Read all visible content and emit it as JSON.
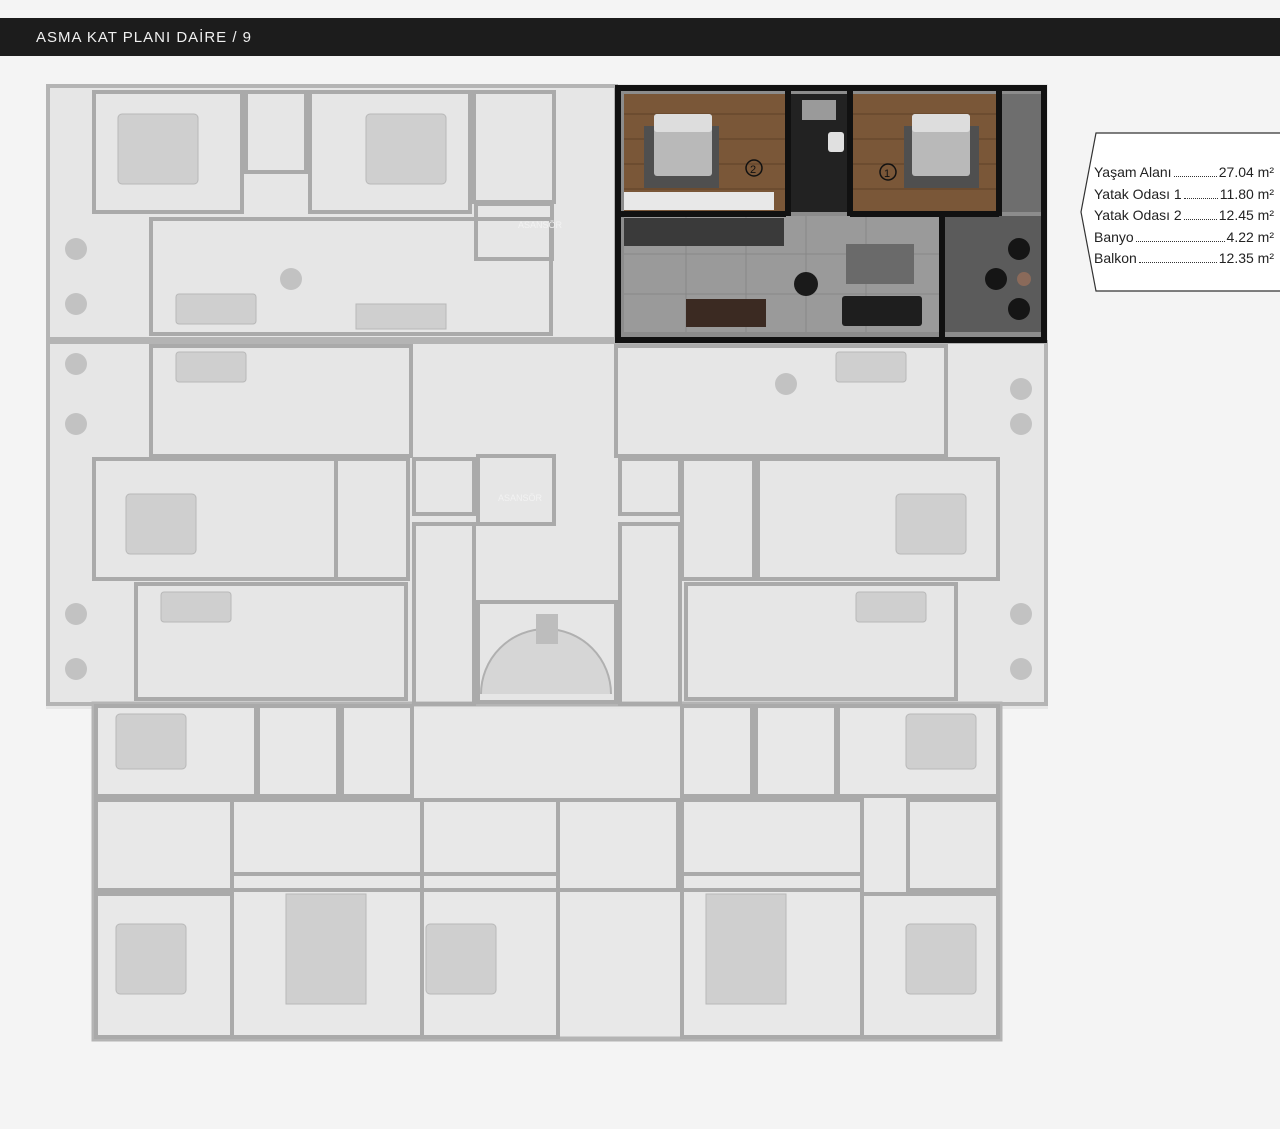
{
  "header": {
    "title": "ASMA KAT PLANI DAİRE / 9"
  },
  "plan": {
    "labels": {
      "elevator_1": "ASANSÖR",
      "elevator_2": "ASANSÖR",
      "room_1": "1",
      "room_2": "2"
    },
    "colors": {
      "highlight_wall": "#111111",
      "wood_floor": "#7a5738",
      "tile_floor": "#9a9a9a",
      "faded_wall": "#9c9c9c",
      "faded_fill": "#dcdcdc"
    }
  },
  "areas": [
    {
      "label": "Yaşam Alanı",
      "value": "27.04 m²"
    },
    {
      "label": "Yatak Odası 1",
      "value": "11.80 m²"
    },
    {
      "label": "Yatak Odası 2",
      "value": "12.45 m²"
    },
    {
      "label": "Banyo",
      "value": "4.22 m²"
    },
    {
      "label": "Balkon",
      "value": "12.35 m²"
    }
  ]
}
